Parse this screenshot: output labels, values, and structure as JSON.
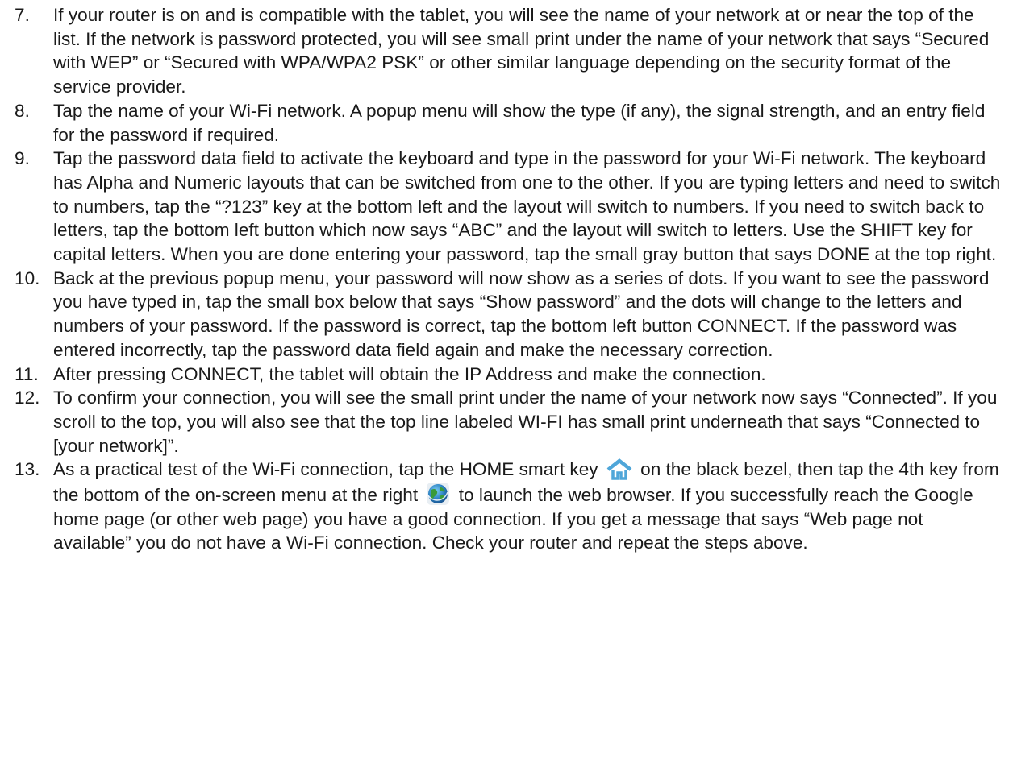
{
  "steps": [
    {
      "number": "7.",
      "text": "If your router is on and is compatible with the tablet, you will see the name of your network at or near the top of the list. If the network is password protected, you will see small print under the name of your network that says “Secured with WEP” or “Secured with WPA/WPA2 PSK” or other similar language depending on the security format of the service provider."
    },
    {
      "number": "8.",
      "text": "Tap the name of your Wi-Fi network. A popup menu will show the type (if any), the signal strength, and an entry field for the password if required."
    },
    {
      "number": "9.",
      "text": "Tap the password data field to activate the keyboard and type in the password for your Wi-Fi network. The keyboard has Alpha and Numeric layouts that can be switched from one to the other. If you are typing letters and need to switch to numbers, tap the “?123” key at the bottom left and the layout will switch to numbers. If you need to switch back to letters, tap the bottom left button which now says “ABC” and the layout will switch to letters. Use the SHIFT key for capital letters. When you are done entering your password, tap the small gray button that says DONE at the top right."
    },
    {
      "number": "10.",
      "text": "Back at the previous popup menu, your password will now show as a series of dots. If you want to see the password you have typed in, tap the small box below that says “Show password” and the dots will change to the letters and numbers of your password. If the password is correct, tap the bottom left button CONNECT. If the password was entered incorrectly, tap the password data field again and make the necessary correction."
    },
    {
      "number": "11.",
      "text": "After pressing CONNECT, the tablet will obtain the IP Address and make the connection."
    },
    {
      "number": "12.",
      "text": "To confirm your connection, you will see the small print under the name of your network now says “Connected”. If you scroll to the top, you will also see that the top line labeled WI-FI has small print underneath that says “Connected to [your network]”."
    },
    {
      "number": "13.",
      "text_before_home_icon": "As a practical test of the Wi-Fi connection, tap the HOME smart key",
      "text_before_browser_icon": "on the black bezel, then tap the 4th key from the bottom of the on-screen menu at the right",
      "text_after_browser_icon": "to launch the web browser. If you successfully reach the Google home page (or other web page) you have a good connection. If you get a message that says “Web page not available” you do not have a Wi-Fi connection. Check your router and repeat the steps above."
    }
  ],
  "icons": {
    "home": "home-icon",
    "browser": "browser-globe-icon",
    "home_color": "#4fa6d9",
    "browser_color": "#2a7fc1"
  }
}
